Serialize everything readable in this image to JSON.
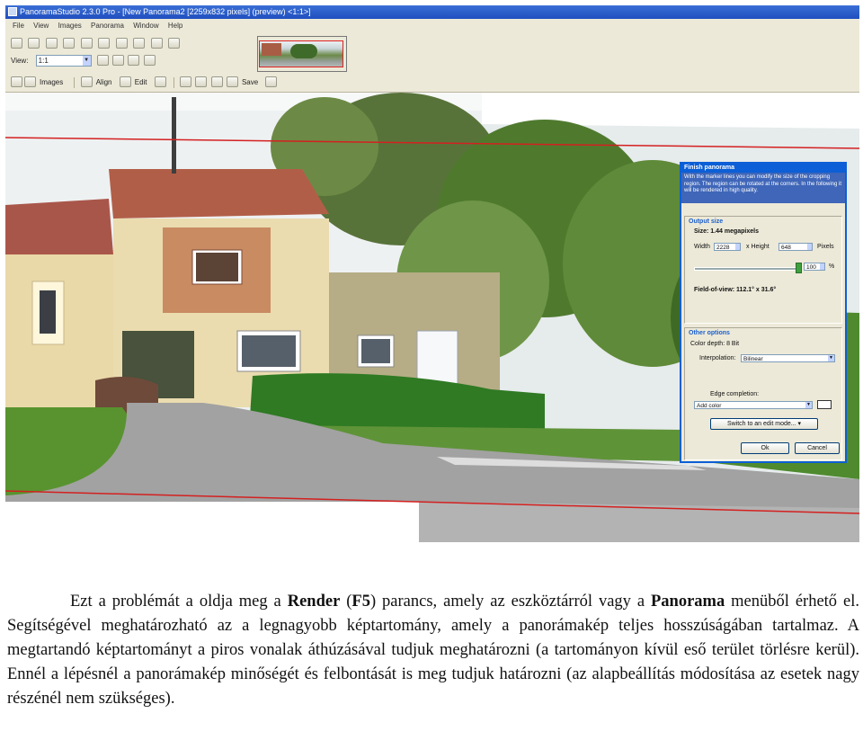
{
  "window": {
    "title": "PanoramaStudio 2.3.0 Pro - [New Panorama2 [2259x832 pixels] (preview) <1:1>]"
  },
  "menu": [
    "File",
    "View",
    "Images",
    "Panorama",
    "Window",
    "Help"
  ],
  "toolbar": {
    "view_label": "View:",
    "zoom_value": "1:1",
    "images_label": "Images",
    "align_label": "Align",
    "edit_label": "Edit",
    "save_label": "Save"
  },
  "dialog": {
    "title": "Finish panorama",
    "info": "With the marker lines you can modify the size of the cropping region. The region can be rotated at the corners. In the following it will be rendered in high quality.",
    "output_size_header": "Output size",
    "size_text": "Size: 1.44 megapixels",
    "width_label": "Width",
    "width_value": "2228",
    "height_label": "x Height",
    "height_value": "648",
    "pixels_label": "Pixels",
    "percent_value": "100",
    "percent_unit": "%",
    "fov_text": "Field-of-view: 112.1° x 31.6°",
    "other_options_header": "Other options",
    "color_depth": "Color depth: 8 Bit",
    "interpolation_label": "Interpolation:",
    "interpolation_value": "Bilinear",
    "edge_label": "Edge completion:",
    "edge_value": "Add color",
    "edit_mode_button": "Switch to an edit mode...",
    "ok_button": "Ok",
    "cancel_button": "Cancel"
  },
  "paragraph": {
    "t1": "Ezt a problémát a oldja meg a ",
    "b1": "Render",
    "t2": " (",
    "b2": "F5",
    "t3": ") parancs, amely az eszköztárról vagy a ",
    "b3": "Panorama",
    "t4": " menüből érhető el. Segítségével meghatározható az a legnagyobb képtartomány, amely a panorámakép teljes hosszúságában tartalmaz. A megtartandó képtartományt a piros vonalak áthúzásával tudjuk meghatározni (a tartományon kívül eső terület törlésre kerül). Ennél a lépésnél a panorámakép minőségét és felbontását is meg tudjuk határozni (az alapbeállítás módosítása az esetek nagy részénél nem szükséges)."
  },
  "colors": {
    "crop_line": "#d42020",
    "title_bar": "#1f4fbf",
    "dialog_border": "#0c5fd6"
  }
}
